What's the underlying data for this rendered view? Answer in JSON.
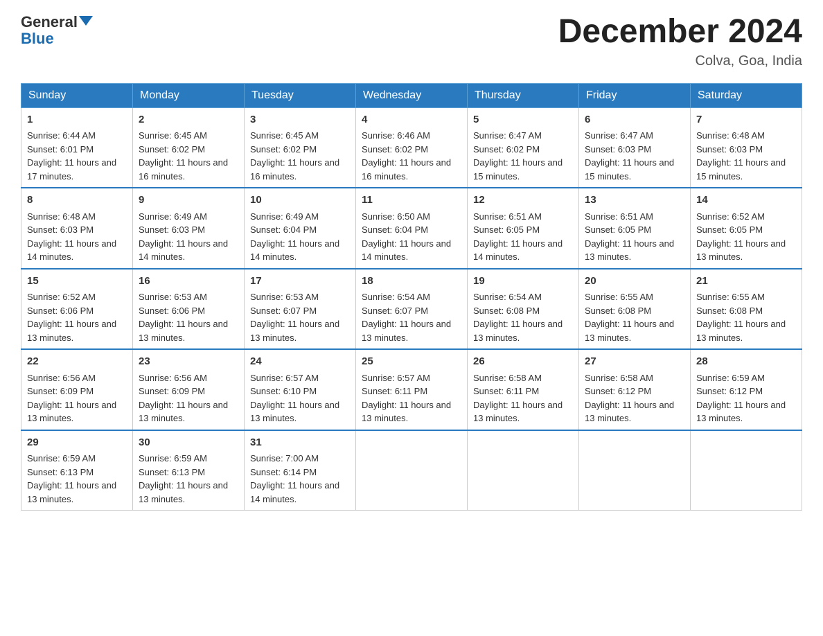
{
  "logo": {
    "general": "General",
    "blue": "Blue"
  },
  "title": "December 2024",
  "location": "Colva, Goa, India",
  "days_of_week": [
    "Sunday",
    "Monday",
    "Tuesday",
    "Wednesday",
    "Thursday",
    "Friday",
    "Saturday"
  ],
  "weeks": [
    [
      {
        "day": "1",
        "sunrise": "6:44 AM",
        "sunset": "6:01 PM",
        "daylight": "11 hours and 17 minutes."
      },
      {
        "day": "2",
        "sunrise": "6:45 AM",
        "sunset": "6:02 PM",
        "daylight": "11 hours and 16 minutes."
      },
      {
        "day": "3",
        "sunrise": "6:45 AM",
        "sunset": "6:02 PM",
        "daylight": "11 hours and 16 minutes."
      },
      {
        "day": "4",
        "sunrise": "6:46 AM",
        "sunset": "6:02 PM",
        "daylight": "11 hours and 16 minutes."
      },
      {
        "day": "5",
        "sunrise": "6:47 AM",
        "sunset": "6:02 PM",
        "daylight": "11 hours and 15 minutes."
      },
      {
        "day": "6",
        "sunrise": "6:47 AM",
        "sunset": "6:03 PM",
        "daylight": "11 hours and 15 minutes."
      },
      {
        "day": "7",
        "sunrise": "6:48 AM",
        "sunset": "6:03 PM",
        "daylight": "11 hours and 15 minutes."
      }
    ],
    [
      {
        "day": "8",
        "sunrise": "6:48 AM",
        "sunset": "6:03 PM",
        "daylight": "11 hours and 14 minutes."
      },
      {
        "day": "9",
        "sunrise": "6:49 AM",
        "sunset": "6:03 PM",
        "daylight": "11 hours and 14 minutes."
      },
      {
        "day": "10",
        "sunrise": "6:49 AM",
        "sunset": "6:04 PM",
        "daylight": "11 hours and 14 minutes."
      },
      {
        "day": "11",
        "sunrise": "6:50 AM",
        "sunset": "6:04 PM",
        "daylight": "11 hours and 14 minutes."
      },
      {
        "day": "12",
        "sunrise": "6:51 AM",
        "sunset": "6:05 PM",
        "daylight": "11 hours and 14 minutes."
      },
      {
        "day": "13",
        "sunrise": "6:51 AM",
        "sunset": "6:05 PM",
        "daylight": "11 hours and 13 minutes."
      },
      {
        "day": "14",
        "sunrise": "6:52 AM",
        "sunset": "6:05 PM",
        "daylight": "11 hours and 13 minutes."
      }
    ],
    [
      {
        "day": "15",
        "sunrise": "6:52 AM",
        "sunset": "6:06 PM",
        "daylight": "11 hours and 13 minutes."
      },
      {
        "day": "16",
        "sunrise": "6:53 AM",
        "sunset": "6:06 PM",
        "daylight": "11 hours and 13 minutes."
      },
      {
        "day": "17",
        "sunrise": "6:53 AM",
        "sunset": "6:07 PM",
        "daylight": "11 hours and 13 minutes."
      },
      {
        "day": "18",
        "sunrise": "6:54 AM",
        "sunset": "6:07 PM",
        "daylight": "11 hours and 13 minutes."
      },
      {
        "day": "19",
        "sunrise": "6:54 AM",
        "sunset": "6:08 PM",
        "daylight": "11 hours and 13 minutes."
      },
      {
        "day": "20",
        "sunrise": "6:55 AM",
        "sunset": "6:08 PM",
        "daylight": "11 hours and 13 minutes."
      },
      {
        "day": "21",
        "sunrise": "6:55 AM",
        "sunset": "6:08 PM",
        "daylight": "11 hours and 13 minutes."
      }
    ],
    [
      {
        "day": "22",
        "sunrise": "6:56 AM",
        "sunset": "6:09 PM",
        "daylight": "11 hours and 13 minutes."
      },
      {
        "day": "23",
        "sunrise": "6:56 AM",
        "sunset": "6:09 PM",
        "daylight": "11 hours and 13 minutes."
      },
      {
        "day": "24",
        "sunrise": "6:57 AM",
        "sunset": "6:10 PM",
        "daylight": "11 hours and 13 minutes."
      },
      {
        "day": "25",
        "sunrise": "6:57 AM",
        "sunset": "6:11 PM",
        "daylight": "11 hours and 13 minutes."
      },
      {
        "day": "26",
        "sunrise": "6:58 AM",
        "sunset": "6:11 PM",
        "daylight": "11 hours and 13 minutes."
      },
      {
        "day": "27",
        "sunrise": "6:58 AM",
        "sunset": "6:12 PM",
        "daylight": "11 hours and 13 minutes."
      },
      {
        "day": "28",
        "sunrise": "6:59 AM",
        "sunset": "6:12 PM",
        "daylight": "11 hours and 13 minutes."
      }
    ],
    [
      {
        "day": "29",
        "sunrise": "6:59 AM",
        "sunset": "6:13 PM",
        "daylight": "11 hours and 13 minutes."
      },
      {
        "day": "30",
        "sunrise": "6:59 AM",
        "sunset": "6:13 PM",
        "daylight": "11 hours and 13 minutes."
      },
      {
        "day": "31",
        "sunrise": "7:00 AM",
        "sunset": "6:14 PM",
        "daylight": "11 hours and 14 minutes."
      },
      null,
      null,
      null,
      null
    ]
  ],
  "labels": {
    "sunrise_prefix": "Sunrise: ",
    "sunset_prefix": "Sunset: ",
    "daylight_prefix": "Daylight: "
  }
}
